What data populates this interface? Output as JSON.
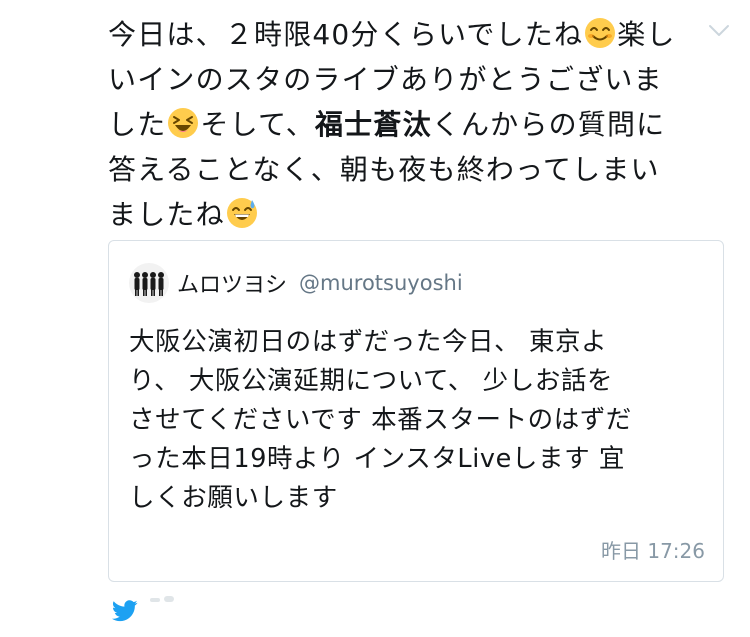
{
  "tweet": {
    "lines": [
      [
        "今日は、２時限40分くらいでしたね",
        "楽し"
      ],
      [
        "いインのスタのライブありがとうございま"
      ],
      [
        "した",
        "そして、",
        "福士蒼汰",
        "くんからの質問に"
      ],
      [
        "答えることなく、朝も夜も終わってしまい"
      ],
      [
        "ましたね"
      ]
    ],
    "emojis": [
      "smiling-face-emoji",
      "laughing-face-emoji",
      "sweat-smile-emoji"
    ]
  },
  "quote": {
    "name": "ムロツヨシ",
    "handle": "@murotsuyoshi",
    "body_lines": [
      "大阪公演初日のはずだった今日、 東京よ",
      "り、 大阪公演延期について、 少しお話を",
      "させてくださいです 本番スタートのはずだ",
      "った本日19時より インスタLiveします 宜",
      "しくお願いします"
    ],
    "timestamp": "昨日 17:26"
  },
  "colors": {
    "text": "#14171a",
    "secondary": "#657786",
    "border": "#d9e0e6",
    "twitter_blue": "#1da1f2",
    "caret": "#ccd6dd"
  },
  "icons": [
    "chevron-down-icon",
    "twitter-bird-icon"
  ]
}
